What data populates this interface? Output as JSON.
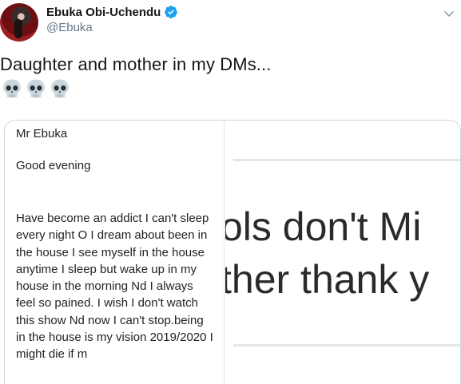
{
  "tweet": {
    "author": {
      "display_name": "Ebuka Obi-Uchendu",
      "handle": "@Ebuka",
      "verified": true,
      "avatar_icon": "profile-photo"
    },
    "text": "Daughter and mother in my DMs...",
    "emojis": [
      "skull",
      "skull",
      "skull"
    ],
    "menu_icon": "chevron-down-icon"
  },
  "media": {
    "left_message": {
      "greeting": "Mr Ebuka",
      "line2": "Good evening",
      "body": "Have become an addict I can't sleep every night O I dream about been in the house I see myself in the house anytime I sleep but wake up in my house in the morning Nd I always feel so pained. I wish I don't watch this show Nd now I can't stop.being in the house is my vision 2019/2020 I might die if m"
    },
    "right_fragment": {
      "line1": "ols don't Mi",
      "line2": "ther thank y"
    }
  },
  "colors": {
    "verified": "#1da1f2",
    "handle": "#657786",
    "text": "#14171a"
  }
}
